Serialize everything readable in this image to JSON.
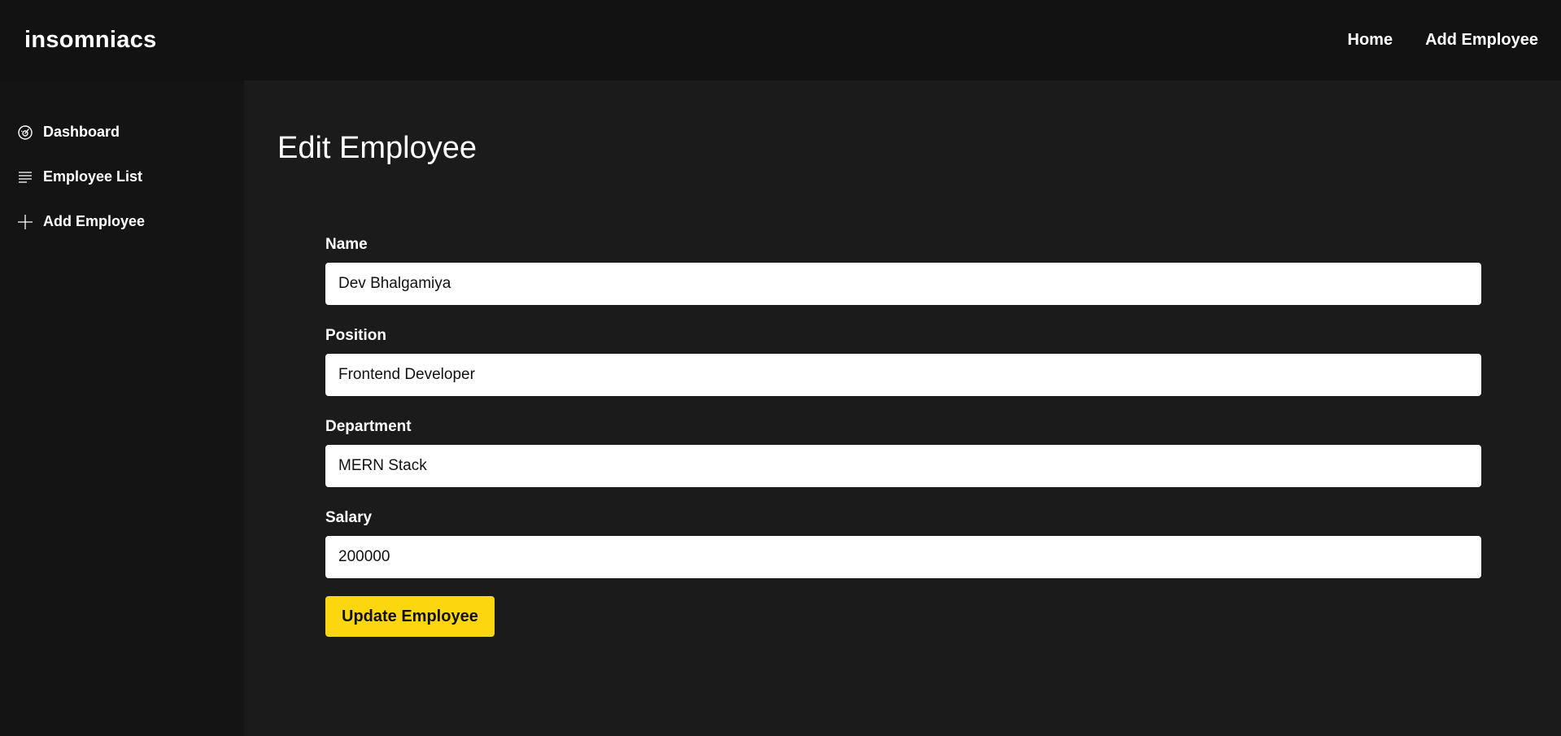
{
  "header": {
    "brand": "insomniacs",
    "nav": [
      {
        "label": "Home"
      },
      {
        "label": "Add Employee"
      }
    ]
  },
  "sidebar": {
    "items": [
      {
        "label": "Dashboard",
        "icon": "dashboard-gauge-icon"
      },
      {
        "label": "Employee List",
        "icon": "list-lines-icon"
      },
      {
        "label": "Add Employee",
        "icon": "plus-icon"
      }
    ]
  },
  "main": {
    "title": "Edit Employee",
    "form": {
      "fields": [
        {
          "label": "Name",
          "value": "Dev Bhalgamiya"
        },
        {
          "label": "Position",
          "value": "Frontend Developer"
        },
        {
          "label": "Department",
          "value": "MERN Stack"
        },
        {
          "label": "Salary",
          "value": "200000"
        }
      ],
      "submit_label": "Update Employee"
    }
  },
  "colors": {
    "topbar_bg": "#121212",
    "sidebar_bg": "#141414",
    "main_bg": "#1b1b1b",
    "button_accent": "#fcd60f"
  }
}
